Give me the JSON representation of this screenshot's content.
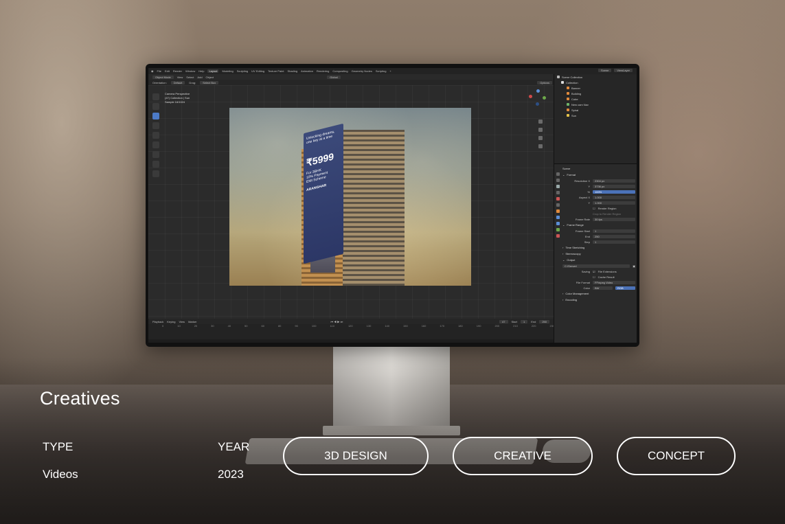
{
  "blender": {
    "menu": [
      "File",
      "Edit",
      "Render",
      "Window",
      "Help"
    ],
    "workspaces": [
      "Layout",
      "Modeling",
      "Sculpting",
      "UV Editing",
      "Texture Paint",
      "Shading",
      "Animation",
      "Rendering",
      "Compositing",
      "Geometry Nodes",
      "Scripting"
    ],
    "active_workspace": "Layout",
    "scene_name": "Scene",
    "view_layer": "ViewLayer",
    "mode": "Object Mode",
    "header_menu": [
      "View",
      "Select",
      "Add",
      "Object"
    ],
    "transform": "Global",
    "orientation_label": "Orientation:",
    "orientation_value": "Default",
    "drag_label": "Drag:",
    "drag_value": "Select Box",
    "options": "Options",
    "view_info": [
      "Camera Perspective",
      "(47) Collection | Sun",
      "Sample 16/1024"
    ],
    "banner": {
      "tagline": "Unlocking dreams, one key at a time",
      "price": "₹5999",
      "sub": [
        "For 3BHK",
        "10% Payment",
        "EMI Scheme"
      ],
      "brand": "ARANGHAR"
    },
    "outliner": {
      "root": "Scene Collection",
      "collection": "Collection",
      "items": [
        "Banner",
        "Building",
        "Cube",
        "New cam Nav",
        "Spiral",
        "Sun"
      ]
    },
    "properties": {
      "scene": "Scene",
      "format_header": "Format",
      "resolution_x_label": "Resolution X",
      "resolution_x": "2304 px",
      "resolution_y_label": "Y",
      "resolution_y": "3736 px",
      "percent_label": "%",
      "percent": "100%",
      "aspect_x_label": "Aspect X",
      "aspect_x": "1.000",
      "aspect_y_label": "Y",
      "aspect_y": "1.000",
      "render_region": "Render Region",
      "crop": "Crop to Render Region",
      "frame_rate_label": "Frame Rate",
      "frame_rate": "30 fps",
      "frame_range_header": "Frame Range",
      "frame_start_label": "Frame Start",
      "frame_start": "1",
      "end_label": "End",
      "end": "250",
      "step_label": "Step",
      "step": "1",
      "time_stretching": "Time Stretching",
      "stereoscopy": "Stereoscopy",
      "output_header": "Output",
      "output_path": "C:\\Server\\",
      "saving_label": "Saving",
      "file_extensions": "File Extensions",
      "cache_result": "Cache Result",
      "file_format_label": "File Format",
      "file_format": "FFmpeg Video",
      "color_label": "Color",
      "color_bw": "BW",
      "color_rgb": "RGB",
      "color_management": "Color Management",
      "encoding": "Encoding"
    },
    "timeline": {
      "menu": [
        "Playback",
        "Keying",
        "View",
        "Marker"
      ],
      "current_frame": "47",
      "start_label": "Start",
      "start": "1",
      "end_label": "End",
      "end": "250",
      "ticks": [
        "0",
        "10",
        "20",
        "30",
        "40",
        "50",
        "60",
        "80",
        "90",
        "100",
        "110",
        "120",
        "130",
        "140",
        "150",
        "160",
        "170",
        "180",
        "190",
        "200",
        "210",
        "220",
        "230",
        "240",
        "250"
      ]
    }
  },
  "caption": {
    "title": "Creatives",
    "type_label": "TYPE",
    "type_value": "Videos",
    "year_label": "YEAR",
    "year_value": "2023",
    "tags": [
      "3D DESIGN",
      "CREATIVE",
      "CONCEPT"
    ]
  }
}
